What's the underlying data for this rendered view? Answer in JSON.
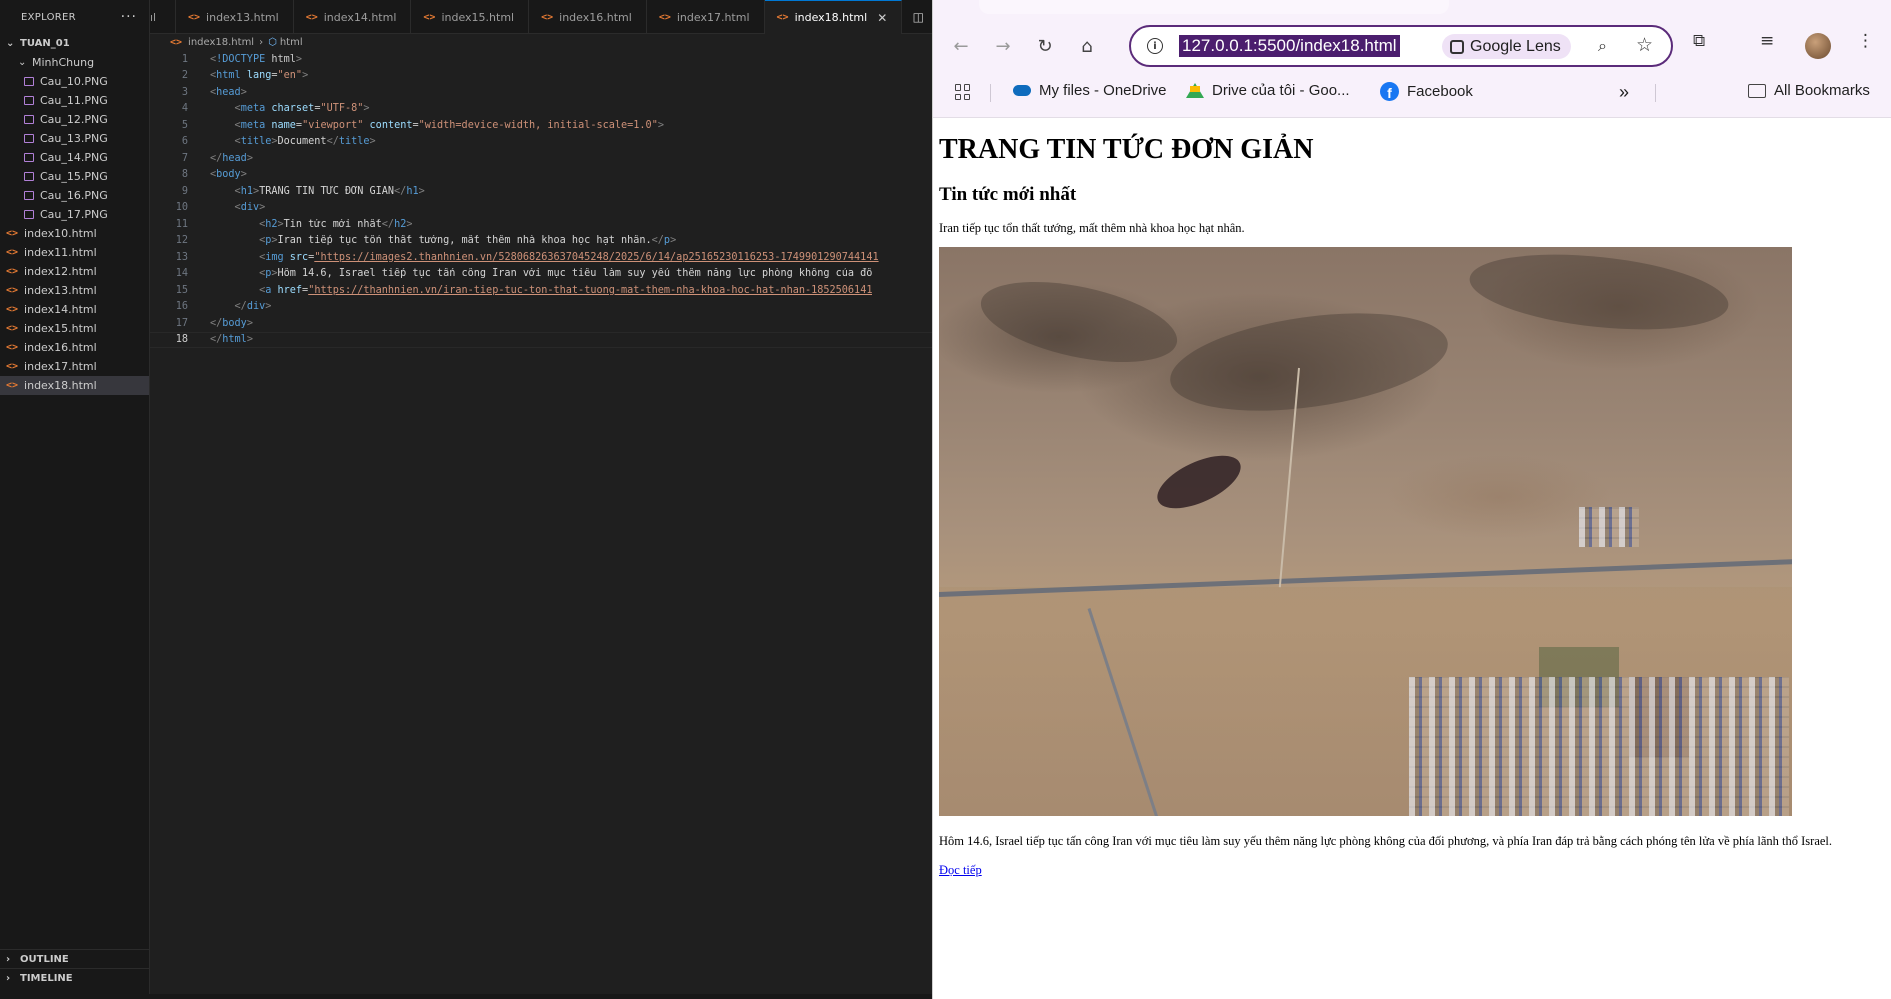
{
  "explorer": {
    "title": "EXPLORER",
    "more": "···",
    "root": "TUAN_01",
    "folder": "MinhChung",
    "png_files": [
      "Cau_10.PNG",
      "Cau_11.PNG",
      "Cau_12.PNG",
      "Cau_13.PNG",
      "Cau_14.PNG",
      "Cau_15.PNG",
      "Cau_16.PNG",
      "Cau_17.PNG"
    ],
    "html_files": [
      "index10.html",
      "index11.html",
      "index12.html",
      "index13.html",
      "index14.html",
      "index15.html",
      "index16.html",
      "index17.html",
      "index18.html"
    ],
    "outline": "OUTLINE",
    "timeline": "TIMELINE"
  },
  "editor": {
    "tabs": [
      "ıl",
      "index13.html",
      "index14.html",
      "index15.html",
      "index16.html",
      "index17.html",
      "index18.html"
    ],
    "active_tab": "index18.html",
    "breadcrumb_file": "index18.html",
    "breadcrumb_symbol": "html",
    "lines": [
      "<!DOCTYPE html>",
      "<html lang=\"en\">",
      "<head>",
      "    <meta charset=\"UTF-8\">",
      "    <meta name=\"viewport\" content=\"width=device-width, initial-scale=1.0\">",
      "    <title>Document</title>",
      "</head>",
      "<body>",
      "    <h1>TRANG TIN TỨC ĐƠN GIẢN</h1>",
      "    <div>",
      "        <h2>Tin tức mới nhất</h2>",
      "        <p>Iran tiếp tục tổn thất tướng, mất thêm nhà khoa học hạt nhân.</p>",
      "        <img src=\"https://images2.thanhnien.vn/528068263637045248/2025/6/14/ap25165230116253-1749901290744141",
      "        <p>Hôm 14.6, Israel tiếp tục tấn công Iran với mục tiêu làm suy yếu thêm năng lực phòng không của đố",
      "        <a href=\"https://thanhnien.vn/iran-tiep-tuc-ton-that-tuong-mat-them-nha-khoa-hoc-hat-nhan-1852506141",
      "    </div>",
      "</body>",
      "</html>"
    ]
  },
  "browser": {
    "url": "127.0.0.1:5500/index18.html",
    "lens_label": "Google Lens",
    "bookmarks": [
      "My files - OneDrive",
      "Drive của tôi - Goo...",
      "Facebook"
    ],
    "all_bookmarks": "All Bookmarks",
    "overflow": "»"
  },
  "page": {
    "h1": "TRANG TIN TỨC ĐƠN GIẢN",
    "h2": "Tin tức mới nhất",
    "lead": "Iran tiếp tục tổn thất tướng, mất thêm nhà khoa học hạt nhân.",
    "body": "Hôm 14.6, Israel tiếp tục tấn công Iran với mục tiêu làm suy yếu thêm năng lực phòng không của đối phương, và phía Iran đáp trả bằng cách phóng tên lửa về phía lãnh thổ Israel.",
    "link": "Đọc tiếp"
  }
}
